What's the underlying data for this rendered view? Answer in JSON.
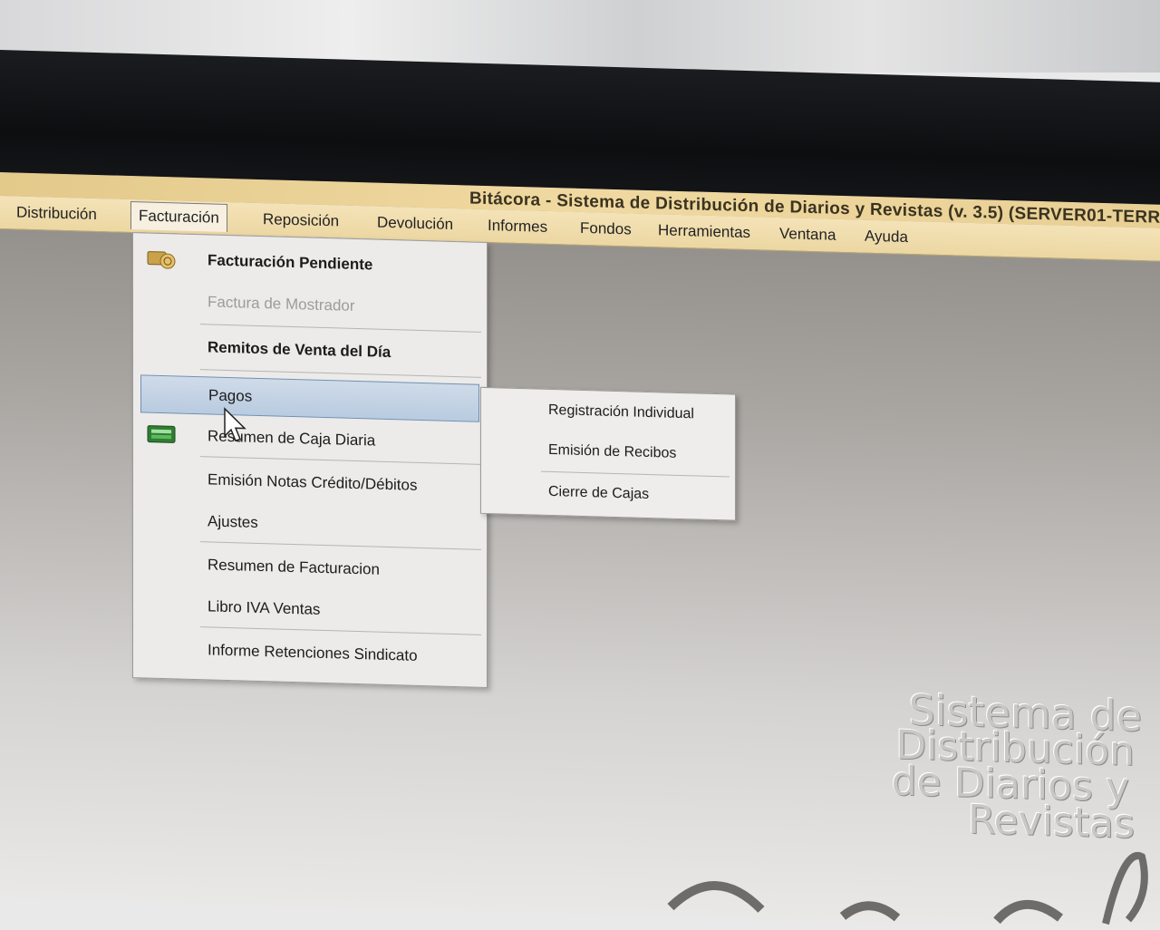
{
  "window": {
    "title": "Bitácora - Sistema de Distribución de Diarios y Revistas (v. 3.5) (SERVER01-TERR"
  },
  "menubar": [
    {
      "label": "Distribución"
    },
    {
      "label": "Facturación",
      "active": true
    },
    {
      "label": "Reposición"
    },
    {
      "label": "Devolución"
    },
    {
      "label": "Informes"
    },
    {
      "label": "Fondos"
    },
    {
      "label": "Herramientas"
    },
    {
      "label": "Ventana"
    },
    {
      "label": "Ayuda"
    }
  ],
  "facturacion_menu": [
    {
      "label": "Facturación Pendiente",
      "icon": "money-icon"
    },
    {
      "label": "Factura de Mostrador",
      "disabled": true
    },
    {
      "label": "Remitos de Venta del Día"
    },
    {
      "label": "Pagos",
      "selected": true,
      "has_submenu": true
    },
    {
      "label": "Resumen de Caja Diaria",
      "icon": "cash-register-icon"
    },
    {
      "label": "Emisión Notas Crédito/Débitos"
    },
    {
      "label": "Ajustes"
    },
    {
      "label": "Resumen de Facturacion"
    },
    {
      "label": "Libro IVA Ventas"
    },
    {
      "label": "Informe Retenciones Sindicato"
    }
  ],
  "pagos_submenu": [
    {
      "label": "Registración Individual"
    },
    {
      "label": "Emisión de Recibos"
    },
    {
      "label": "Cierre de Cajas"
    }
  ],
  "brand": {
    "line1": "Sistema de",
    "line2": "Distribución",
    "line3": "de Diarios  y",
    "line4": "Revistas"
  },
  "colors": {
    "menubar": "#ecd7a2",
    "selection": "#b9cbe0",
    "menu_background": "#ecebe9"
  }
}
